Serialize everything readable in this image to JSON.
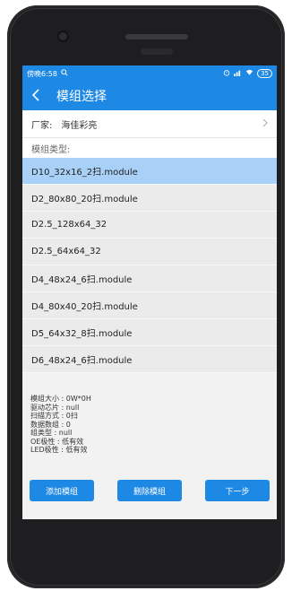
{
  "status_bar": {
    "time": "傍晚6:58",
    "battery": "35"
  },
  "header": {
    "title": "模组选择"
  },
  "vendor": {
    "label": "厂家:",
    "value": "海佳彩亮"
  },
  "module_type_label": "模组类型:",
  "modules": [
    "D10_32x16_2扫.module",
    "D2_80x80_20扫.module",
    "D2.5_128x64_32",
    "D2.5_64x64_32",
    "D4_48x24_6扫.module",
    "D4_80x40_20扫.module",
    "D5_64x32_8扫.module",
    "D6_48x24_6扫.module"
  ],
  "selected_index": 0,
  "info": {
    "size": "模组大小 : 0W*0H",
    "chip": "驱动芯片 : null",
    "scan": "扫描方式 : 0扫",
    "data_groups": "数据数组 : 0",
    "group_type": "组类型 : null",
    "oe_polarity": "OE极性 : 低有效",
    "led_polarity": "LED极性 : 低有效"
  },
  "buttons": {
    "add": "添加模组",
    "delete": "删除模组",
    "next": "下一步"
  },
  "colors": {
    "primary": "#1e88e5",
    "selected_row": "#a9d1f7",
    "phone_body": "#1e1e20"
  }
}
